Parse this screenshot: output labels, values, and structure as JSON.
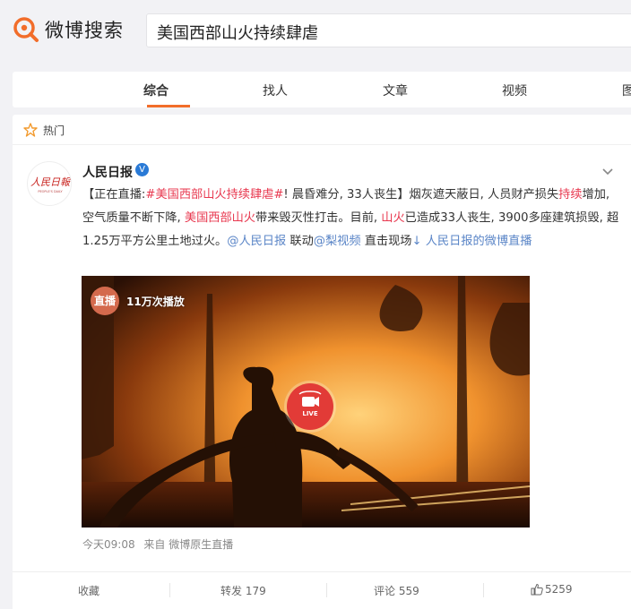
{
  "header": {
    "logo_text": "微博搜索",
    "search_value": "美国西部山火持续肆虐"
  },
  "tabs": [
    {
      "label": "综合",
      "active": true
    },
    {
      "label": "找人",
      "active": false
    },
    {
      "label": "文章",
      "active": false
    },
    {
      "label": "视频",
      "active": false
    },
    {
      "label": "图",
      "active": false
    }
  ],
  "hot": {
    "label": "热门",
    "icon": "fire-icon"
  },
  "post": {
    "author": "人民日报",
    "verified": "V",
    "avatar_text": "人民日報",
    "avatar_subtext": "PEOPLE'S DAILY",
    "text": {
      "p1": "【正在直播:",
      "hashtag": "#美国西部山火持续肆虐#",
      "p2": "! 晨昏难分, 33人丧生】烟灰遮天蔽日, 人员财产损失",
      "kw1": "持续",
      "p3": "增加, 空气质量不断下降, ",
      "kw2": "美国西部山火",
      "p4": "带来毁灭性打击。目前, ",
      "kw3": "山火",
      "p5": "已造成33人丧生, 3900多座建筑损毁, 超1.25万平方公里土地过火。",
      "mention1": "@人民日报",
      "p6": " 联动",
      "mention2": "@梨视频",
      "p7": " 直击现场",
      "live_link": "↓ 人民日报的微博直播"
    },
    "video": {
      "live_badge": "直播",
      "plays": "11万次播放",
      "live_button": "LIVE"
    },
    "time": "今天09:08",
    "source_prefix": "来自",
    "source": "微博原生直播",
    "actions": {
      "favorite": "收藏",
      "repost_label": "转发",
      "repost_count": "179",
      "comment_label": "评论",
      "comment_count": "559",
      "like_count": "5259"
    }
  },
  "colors": {
    "accent": "#f26d2a",
    "highlight": "#e8384f",
    "link": "#5a85c7",
    "live_red": "#e23b37"
  }
}
